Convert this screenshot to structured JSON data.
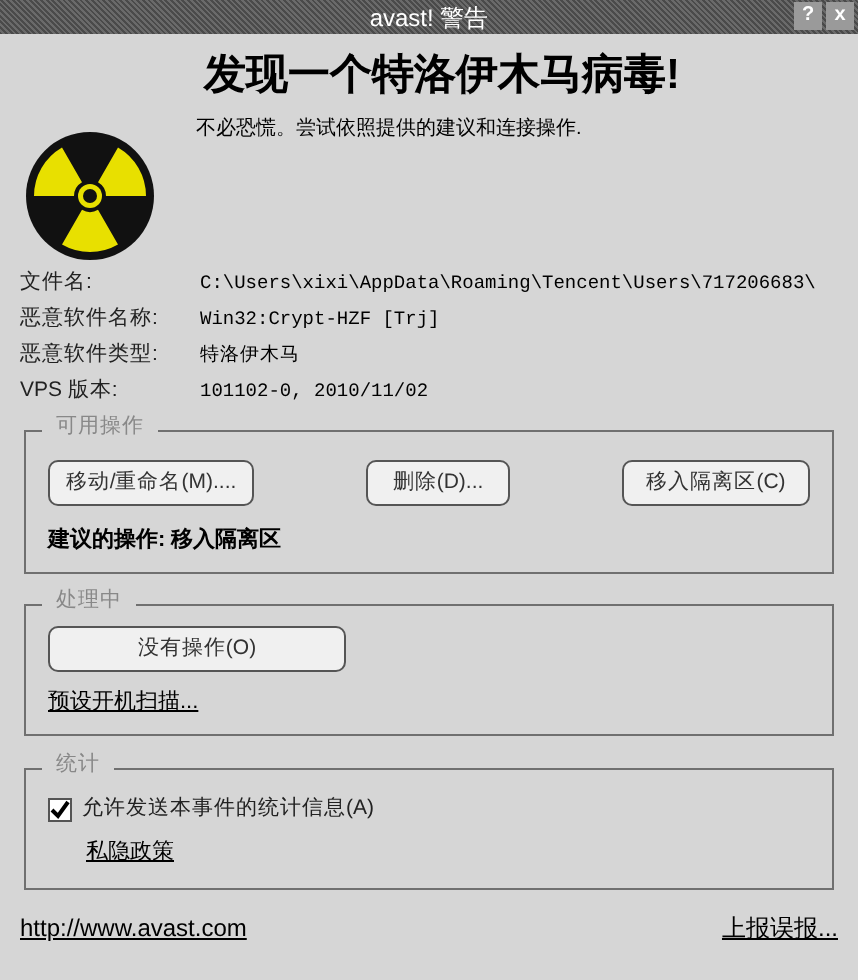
{
  "window": {
    "title": "avast! 警告",
    "buttons": [
      "?",
      "x"
    ]
  },
  "heading": "发现一个特洛伊木马病毒!",
  "subtitle": "不必恐慌。尝试依照提供的建议和连接操作.",
  "details": [
    {
      "label": "文件名:",
      "value": "C:\\Users\\xixi\\AppData\\Roaming\\Tencent\\Users\\717206683\\"
    },
    {
      "label": "恶意软件名称:",
      "value": "Win32:Crypt-HZF [Trj]"
    },
    {
      "label": "恶意软件类型:",
      "value": "特洛伊木马"
    },
    {
      "label": "VPS 版本:",
      "value": "101102-0, 2010/11/02"
    }
  ],
  "actions": {
    "title": "可用操作",
    "buttons": [
      "移动/重命名(M)....",
      "删除(D)...",
      "移入隔离区(C)"
    ],
    "recommendation": "建议的操作: 移入隔离区"
  },
  "processing": {
    "title": "处理中",
    "button": "没有操作(O)",
    "link": "预设开机扫描..."
  },
  "statistics": {
    "title": "统计",
    "checkbox": {
      "label": "允许发送本事件的统计信息(A)",
      "checked": true
    },
    "link": "私隐政策"
  },
  "footer": {
    "website": "http://www.avast.com",
    "report": "上报误报..."
  }
}
